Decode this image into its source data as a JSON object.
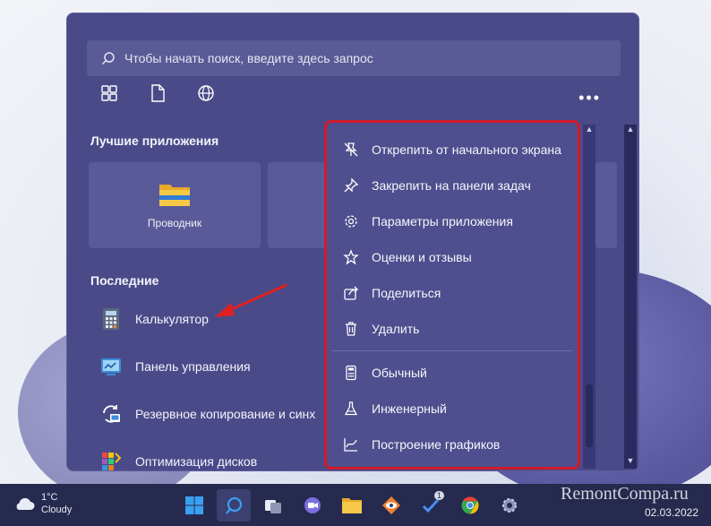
{
  "search": {
    "placeholder": "Чтобы начать поиск, введите здесь запрос"
  },
  "pinned": {
    "title": "Лучшие приложения",
    "tiles": [
      {
        "label": "Проводник",
        "icon": "folder-icon"
      }
    ]
  },
  "recent": {
    "title": "Последние",
    "items": [
      {
        "label": "Калькулятор",
        "icon": "calculator-icon"
      },
      {
        "label": "Панель управления",
        "icon": "control-panel-icon"
      },
      {
        "label": "Резервное копирование и синх",
        "icon": "backup-sync-icon"
      },
      {
        "label": "Оптимизация дисков",
        "icon": "disk-optimize-icon"
      }
    ]
  },
  "context_menu": {
    "items": [
      {
        "label": "Открепить от начального экрана",
        "icon": "unpin-icon"
      },
      {
        "label": "Закрепить на панели задач",
        "icon": "pin-icon"
      },
      {
        "label": "Параметры приложения",
        "icon": "gear-icon"
      },
      {
        "label": "Оценки и отзывы",
        "icon": "star-icon"
      },
      {
        "label": "Поделиться",
        "icon": "share-icon"
      },
      {
        "label": "Удалить",
        "icon": "trash-icon"
      }
    ],
    "modes": [
      {
        "label": "Обычный",
        "icon": "calculator-standard-icon"
      },
      {
        "label": "Инженерный",
        "icon": "flask-icon"
      },
      {
        "label": "Построение графиков",
        "icon": "graph-icon"
      }
    ]
  },
  "taskbar": {
    "weather": {
      "temp": "1°C",
      "condition": "Cloudy"
    },
    "badge_count": "1",
    "date": "02.03.2022"
  },
  "watermark": "RemontCompa.ru",
  "colors": {
    "accent_red": "#d01a2b",
    "menu_bg": "#4b4a89"
  }
}
